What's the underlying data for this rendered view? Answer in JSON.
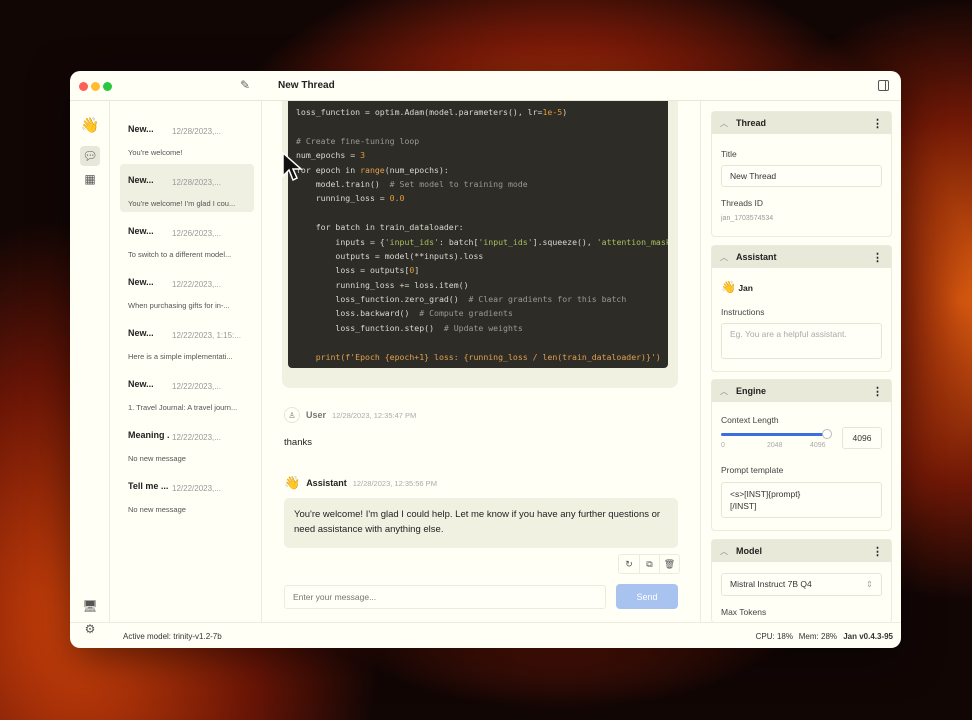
{
  "window": {
    "title": "New Thread"
  },
  "threads": [
    {
      "title": "New...",
      "date": "12/28/2023,...",
      "preview": "You're welcome!"
    },
    {
      "title": "New...",
      "date": "12/28/2023,...",
      "preview": "You're welcome! I'm glad I cou...",
      "selected": true
    },
    {
      "title": "New...",
      "date": "12/26/2023,...",
      "preview": "To switch to a different model..."
    },
    {
      "title": "New...",
      "date": "12/22/2023,...",
      "preview": "When purchasing gifts for in-..."
    },
    {
      "title": "New...",
      "date": "12/22/2023, 1:15:...",
      "preview": "Here is a simple implementati..."
    },
    {
      "title": "New...",
      "date": "12/22/2023,...",
      "preview": "1. Travel Journal: A travel journ..."
    },
    {
      "title": "Meaning ...",
      "date": "12/22/2023,...",
      "preview": "No new message"
    },
    {
      "title": "Tell me ...",
      "date": "12/22/2023,...",
      "preview": "No new message"
    }
  ],
  "code_lines": [
    [
      [
        "loss_function = optim.Adam(model.parameters(), lr=",
        "k"
      ],
      [
        "1e-5",
        "n"
      ],
      [
        ")",
        "k"
      ]
    ],
    [],
    [
      [
        "# Create fine-tuning loop",
        "c"
      ]
    ],
    [
      [
        "num_epochs = ",
        "k"
      ],
      [
        "3",
        "n"
      ]
    ],
    [
      [
        "for epoch in ",
        "k"
      ],
      [
        "range",
        "f"
      ],
      [
        "(num_epochs):",
        "k"
      ]
    ],
    [
      [
        "    model.train()  ",
        "k"
      ],
      [
        "# Set model to training mode",
        "c"
      ]
    ],
    [
      [
        "    running_loss = ",
        "k"
      ],
      [
        "0.0",
        "n"
      ]
    ],
    [],
    [
      [
        "    for batch in train_dataloader:",
        "k"
      ]
    ],
    [
      [
        "        inputs = {",
        "k"
      ],
      [
        "'input_ids'",
        "s"
      ],
      [
        ": batch[",
        "k"
      ],
      [
        "'input_ids'",
        "s"
      ],
      [
        "].squeeze(), ",
        "k"
      ],
      [
        "'attention_mask'",
        "s"
      ]
    ],
    [
      [
        "        outputs = model(**inputs).loss",
        "k"
      ]
    ],
    [
      [
        "        loss = outputs[",
        "k"
      ],
      [
        "0",
        "n"
      ],
      [
        "]",
        "k"
      ]
    ],
    [
      [
        "        running_loss += loss.item()",
        "k"
      ]
    ],
    [
      [
        "        loss_function.zero_grad()  ",
        "k"
      ],
      [
        "# Clear gradients for this batch",
        "c"
      ]
    ],
    [
      [
        "        loss.backward()  ",
        "k"
      ],
      [
        "# Compute gradients",
        "c"
      ]
    ],
    [
      [
        "        loss_function.step()  ",
        "k"
      ],
      [
        "# Update weights",
        "c"
      ]
    ],
    [],
    [
      [
        "    print(f'Epoch {epoch+1} loss: {running_loss / len(train_dataloader)}')",
        "f"
      ]
    ]
  ],
  "messages": [
    {
      "role": "User",
      "time": "12/28/2023, 12:35:47 PM",
      "text": "thanks"
    },
    {
      "role": "Assistant",
      "time": "12/28/2023, 12:35:56 PM",
      "text": "You're welcome! I'm glad I could help. Let me know if you have any further questions or need assistance with anything else."
    }
  ],
  "composer": {
    "placeholder": "Enter your message...",
    "send": "Send"
  },
  "right": {
    "thread": {
      "header": "Thread",
      "title_label": "Title",
      "title_value": "New Thread",
      "id_label": "Threads ID",
      "id_value": "jan_1703574534"
    },
    "assistant": {
      "header": "Assistant",
      "name": "Jan",
      "instructions_label": "Instructions",
      "instructions_placeholder": "Eg. You are a helpful assistant."
    },
    "engine": {
      "header": "Engine",
      "context_label": "Context Length",
      "context_value": "4096",
      "slider_fraction": 1.0,
      "ticks": [
        "0",
        "2048",
        "4096"
      ],
      "prompt_label": "Prompt template",
      "prompt_value": "<s>[INST]{prompt}\n[/INST]"
    },
    "model": {
      "header": "Model",
      "selected": "Mistral Instruct 7B Q4",
      "max_tokens_label": "Max Tokens"
    }
  },
  "footer": {
    "active_model": "Active model: trinity-v1.2-7b",
    "cpu": "CPU: 18%",
    "mem": "Mem: 28%",
    "version": "Jan v0.4.3-95"
  },
  "colors": {
    "accent": "#3b6fe0",
    "send_disabled": "#a9c3f0"
  }
}
